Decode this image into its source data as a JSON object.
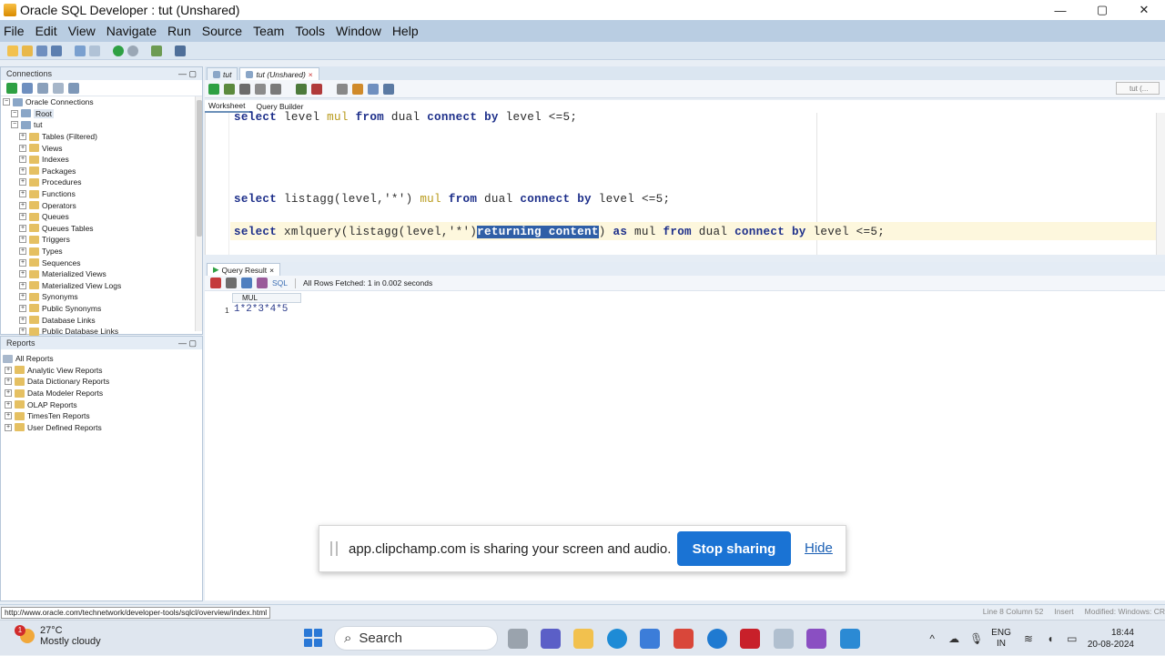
{
  "window": {
    "title": "Oracle SQL Developer : tut (Unshared)",
    "controls": {
      "minimize": "—",
      "maximize": "▢",
      "close": "✕"
    }
  },
  "menu": [
    "File",
    "Edit",
    "View",
    "Navigate",
    "Run",
    "Source",
    "Team",
    "Tools",
    "Window",
    "Help"
  ],
  "connections_pane": {
    "header": "Connections",
    "root_label": "Oracle Connections",
    "items": [
      {
        "label": "Root",
        "level": 1
      },
      {
        "label": "tut",
        "level": 1
      },
      {
        "label": "Tables (Filtered)",
        "level": 2
      },
      {
        "label": "Views",
        "level": 2
      },
      {
        "label": "Indexes",
        "level": 2
      },
      {
        "label": "Packages",
        "level": 2
      },
      {
        "label": "Procedures",
        "level": 2
      },
      {
        "label": "Functions",
        "level": 2
      },
      {
        "label": "Operators",
        "level": 2
      },
      {
        "label": "Queues",
        "level": 2
      },
      {
        "label": "Queues Tables",
        "level": 2
      },
      {
        "label": "Triggers",
        "level": 2
      },
      {
        "label": "Types",
        "level": 2
      },
      {
        "label": "Sequences",
        "level": 2
      },
      {
        "label": "Materialized Views",
        "level": 2
      },
      {
        "label": "Materialized View Logs",
        "level": 2
      },
      {
        "label": "Synonyms",
        "level": 2
      },
      {
        "label": "Public Synonyms",
        "level": 2
      },
      {
        "label": "Database Links",
        "level": 2
      },
      {
        "label": "Public Database Links",
        "level": 2
      }
    ]
  },
  "reports_pane": {
    "header": "Reports",
    "items": [
      {
        "label": "All Reports",
        "level": 0
      },
      {
        "label": "Analytic View Reports",
        "level": 1
      },
      {
        "label": "Data Dictionary Reports",
        "level": 1
      },
      {
        "label": "Data Modeler Reports",
        "level": 1
      },
      {
        "label": "OLAP Reports",
        "level": 1
      },
      {
        "label": "TimesTen Reports",
        "level": 1
      },
      {
        "label": "User Defined Reports",
        "level": 1
      }
    ]
  },
  "editor": {
    "tabs": [
      {
        "label": "tut",
        "active": false
      },
      {
        "label": "tut (Unshared)",
        "active": true
      }
    ],
    "subtabs": [
      "Worksheet",
      "Query Builder"
    ],
    "connection_select": "tut (...",
    "lines": [
      {
        "kw1": "select",
        "rest1": " level ",
        "alias": "mul",
        "kw2": " from",
        "rest2": " dual ",
        "kw3": "connect by",
        "rest3": " level ",
        "tail": "<=5;"
      },
      {
        "kw1": "select",
        "rest1": " listagg(level,'*') ",
        "alias": "mul",
        "kw2": " from",
        "rest2": " dual ",
        "kw3": "connect by",
        "rest3": " level ",
        "tail": "<=5;"
      },
      {
        "kw1": "select",
        "rest1": " xmlquery(listagg(level,'*')",
        "selected": "returning content",
        "after_sel": ") ",
        "kw2": "as",
        "rest2": " mul ",
        "kw4": "from",
        "rest4": " dual ",
        "kw3": "connect by",
        "rest3": " level ",
        "tail": "<=5;"
      }
    ]
  },
  "results": {
    "tab_label": "Query Result",
    "sql_link": "SQL",
    "status": "All Rows Fetched: 1 in 0.002 seconds",
    "columns": [
      "MUL"
    ],
    "rows": [
      {
        "num": "1",
        "MUL": "1*2*3*4*5"
      }
    ]
  },
  "share_banner": {
    "message": "app.clipchamp.com is sharing your screen and audio.",
    "stop_label": "Stop sharing",
    "hide_label": "Hide"
  },
  "statusbar": {
    "url": "http://www.oracle.com/technetwork/developer-tools/sqlcl/overview/index.html",
    "line_col": "Line 8 Column 52",
    "mode": "Insert",
    "modified": "Modified: Windows: CR"
  },
  "taskbar": {
    "weather_temp": "27°C",
    "weather_desc": "Mostly cloudy",
    "weather_badge": "1",
    "search_placeholder": "Search",
    "lang_top": "ENG",
    "lang_bottom": "IN",
    "time": "18:44",
    "date": "20-08-2024"
  },
  "colors": {
    "menubar": "#b9cde2",
    "selection": "#2f5fa7",
    "primary_button": "#1a73d4",
    "alias": "#b89a1a"
  }
}
